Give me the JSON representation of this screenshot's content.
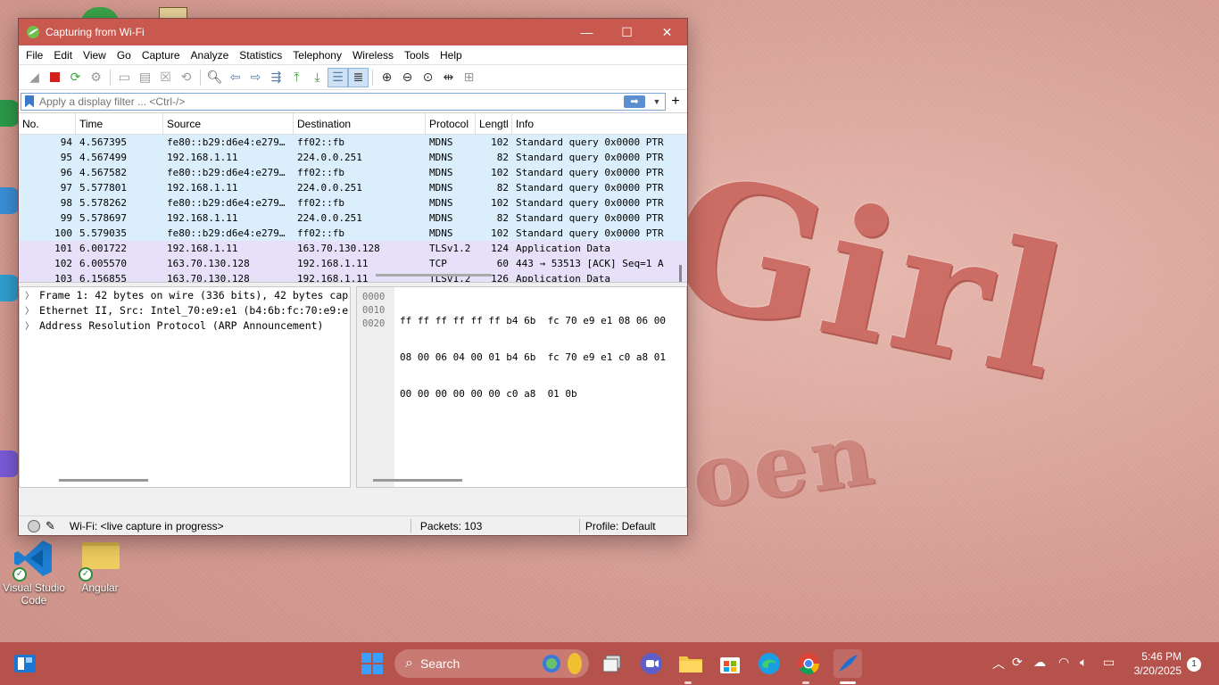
{
  "wallpaper": {
    "word1": "Girl",
    "word2": "oen"
  },
  "desktop": {
    "icons": [
      {
        "label": "Visual Studio Code",
        "icon": "vscode-icon"
      },
      {
        "label": "Angular",
        "icon": "folder-icon"
      }
    ]
  },
  "window": {
    "title": "Capturing from Wi-Fi",
    "menu": [
      "File",
      "Edit",
      "View",
      "Go",
      "Capture",
      "Analyze",
      "Statistics",
      "Telephony",
      "Wireless",
      "Tools",
      "Help"
    ],
    "filter_placeholder": "Apply a display filter ... <Ctrl-/>",
    "columns": [
      "No.",
      "Time",
      "Source",
      "Destination",
      "Protocol",
      "Lengtl",
      "Info"
    ],
    "packets": [
      {
        "no": "94",
        "time": "4.567395",
        "src": "fe80::b29:d6e4:e279…",
        "dst": "ff02::fb",
        "proto": "MDNS",
        "len": "102",
        "info": "Standard query 0x0000 PTR",
        "kind": "mdns"
      },
      {
        "no": "95",
        "time": "4.567499",
        "src": "192.168.1.11",
        "dst": "224.0.0.251",
        "proto": "MDNS",
        "len": "82",
        "info": "Standard query 0x0000 PTR",
        "kind": "mdns"
      },
      {
        "no": "96",
        "time": "4.567582",
        "src": "fe80::b29:d6e4:e279…",
        "dst": "ff02::fb",
        "proto": "MDNS",
        "len": "102",
        "info": "Standard query 0x0000 PTR",
        "kind": "mdns"
      },
      {
        "no": "97",
        "time": "5.577801",
        "src": "192.168.1.11",
        "dst": "224.0.0.251",
        "proto": "MDNS",
        "len": "82",
        "info": "Standard query 0x0000 PTR",
        "kind": "mdns"
      },
      {
        "no": "98",
        "time": "5.578262",
        "src": "fe80::b29:d6e4:e279…",
        "dst": "ff02::fb",
        "proto": "MDNS",
        "len": "102",
        "info": "Standard query 0x0000 PTR",
        "kind": "mdns"
      },
      {
        "no": "99",
        "time": "5.578697",
        "src": "192.168.1.11",
        "dst": "224.0.0.251",
        "proto": "MDNS",
        "len": "82",
        "info": "Standard query 0x0000 PTR",
        "kind": "mdns"
      },
      {
        "no": "100",
        "time": "5.579035",
        "src": "fe80::b29:d6e4:e279…",
        "dst": "ff02::fb",
        "proto": "MDNS",
        "len": "102",
        "info": "Standard query 0x0000 PTR",
        "kind": "mdns"
      },
      {
        "no": "101",
        "time": "6.001722",
        "src": "192.168.1.11",
        "dst": "163.70.130.128",
        "proto": "TLSv1.2",
        "len": "124",
        "info": "Application Data",
        "kind": "tls"
      },
      {
        "no": "102",
        "time": "6.005570",
        "src": "163.70.130.128",
        "dst": "192.168.1.11",
        "proto": "TCP",
        "len": "60",
        "info": "443 → 53513 [ACK] Seq=1 A",
        "kind": "tls"
      },
      {
        "no": "103",
        "time": "6.156855",
        "src": "163.70.130.128",
        "dst": "192.168.1.11",
        "proto": "TLSv1.2",
        "len": "126",
        "info": "Application Data",
        "kind": "tls"
      }
    ],
    "details": [
      "Frame 1: 42 bytes on wire (336 bits), 42 bytes cap",
      "Ethernet II, Src: Intel_70:e9:e1 (b4:6b:fc:70:e9:e",
      "Address Resolution Protocol (ARP Announcement)"
    ],
    "hex": {
      "offsets": [
        "0000",
        "0010",
        "0020"
      ],
      "lines": [
        "ff ff ff ff ff ff b4 6b  fc 70 e9 e1 08 06 00",
        "08 00 06 04 00 01 b4 6b  fc 70 e9 e1 c0 a8 01",
        "00 00 00 00 00 00 c0 a8  01 0b"
      ]
    },
    "status": {
      "interface": "Wi-Fi: <live capture in progress>",
      "packets": "Packets: 103",
      "profile": "Profile: Default"
    }
  },
  "taskbar": {
    "search_label": "Search",
    "time": "5:46 PM",
    "date": "3/20/2025",
    "notifications": "1"
  }
}
